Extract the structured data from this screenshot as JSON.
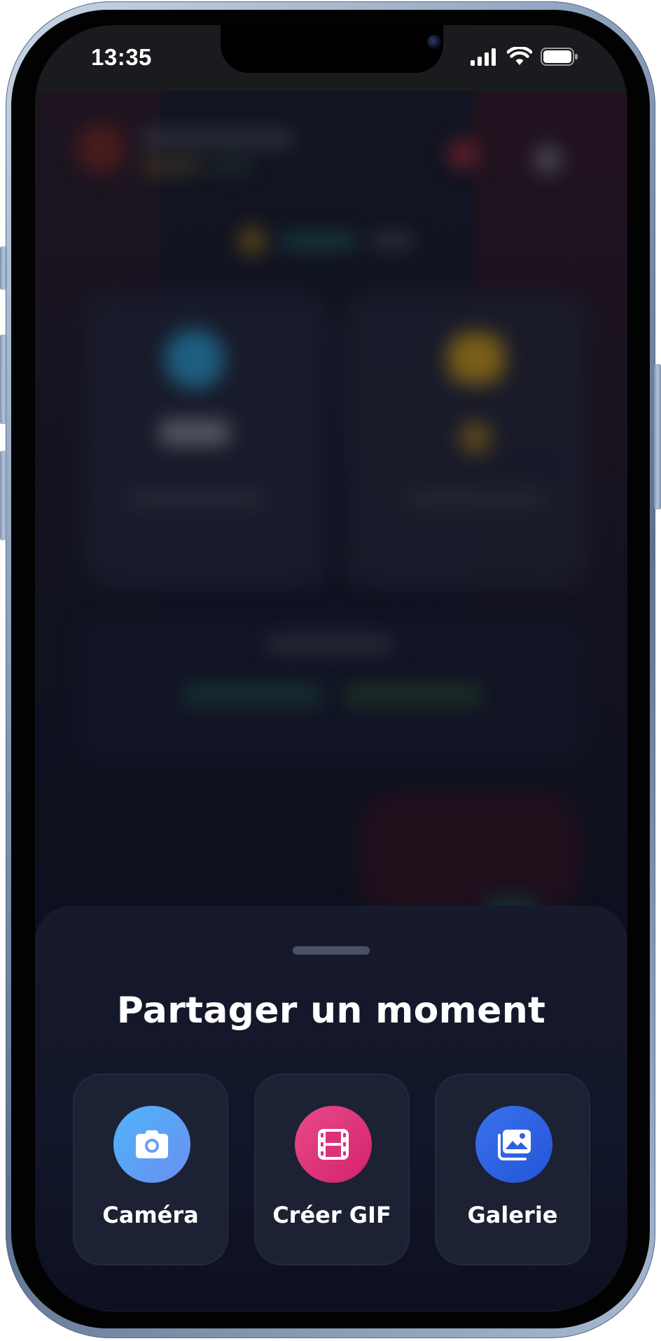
{
  "status_bar": {
    "time": "13:35",
    "icons": [
      "cellular-signal-icon",
      "wifi-icon",
      "battery-icon"
    ]
  },
  "sheet": {
    "title": "Partager un moment",
    "actions": [
      {
        "label": "Caméra",
        "icon": "camera-icon",
        "color": "#4fb4fb"
      },
      {
        "label": "Créer GIF",
        "icon": "film-icon",
        "color": "#e84a8a"
      },
      {
        "label": "Galerie",
        "icon": "gallery-icon",
        "color": "#3a72f0"
      }
    ]
  }
}
